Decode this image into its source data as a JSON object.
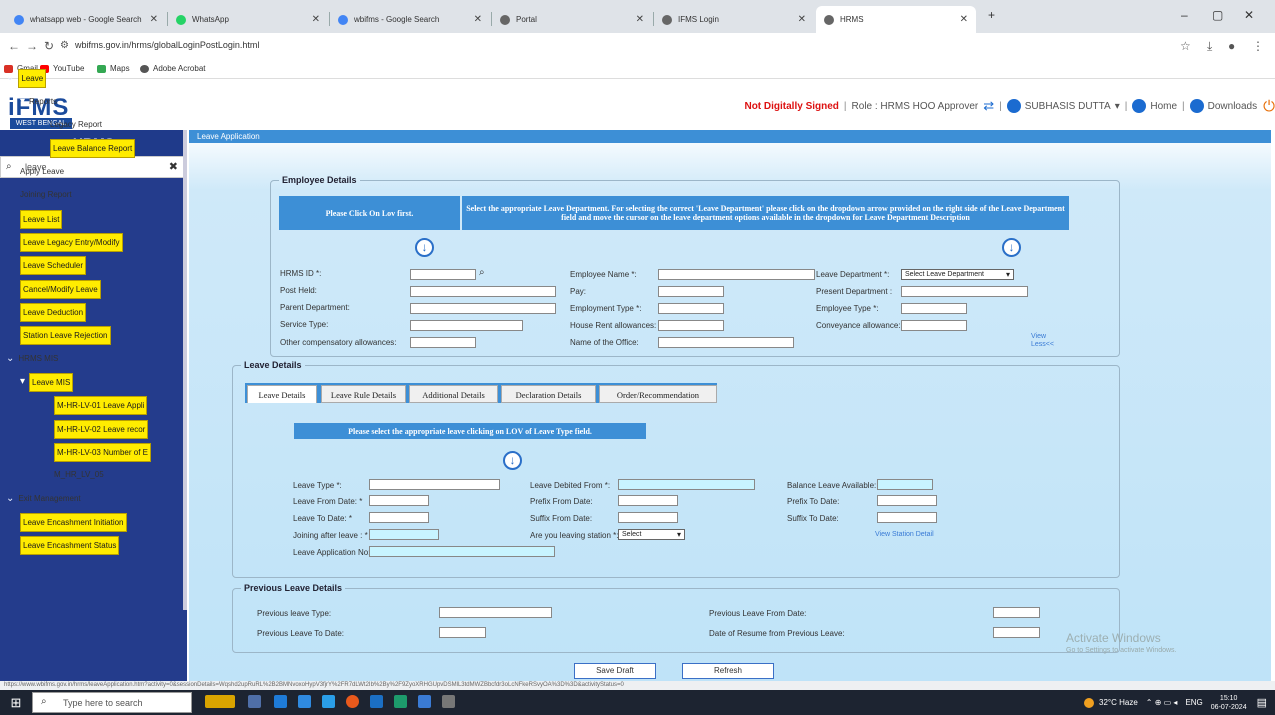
{
  "browser": {
    "tabs": [
      {
        "title": "whatsapp web - Google Search",
        "color": "#4285f4"
      },
      {
        "title": "WhatsApp",
        "color": "#25d366"
      },
      {
        "title": "wbifms - Google Search",
        "color": "#4285f4"
      },
      {
        "title": "Portal",
        "color": "#666666"
      },
      {
        "title": "IFMS Login",
        "color": "#666666"
      },
      {
        "title": "HRMS",
        "color": "#666666"
      }
    ],
    "url": "wbifms.gov.in/hrms/globalLoginPostLogin.html",
    "bookmarks": [
      "Gmail",
      "YouTube",
      "Maps",
      "Adobe Acrobat"
    ]
  },
  "header": {
    "logo": "iFMS",
    "logo_sub": "WEST BENGAL",
    "not_signed": "Not Digitally Signed",
    "role": "Role : HRMS HOO Approver",
    "user": "SUBHASIS DUTTA",
    "home": "Home",
    "downloads": "Downloads"
  },
  "sidebar": {
    "title": "HRMS",
    "search_value": "leave",
    "items": [
      {
        "label": "Leave",
        "hl": true,
        "indent": 0,
        "arrow": "⌄"
      },
      {
        "label": "Reports",
        "hl": false,
        "indent": 1,
        "arrow": "▾"
      },
      {
        "label": "Legacy Report",
        "hl": false,
        "indent": 2,
        "arrow": ""
      },
      {
        "label": "Leave Balance Report",
        "hl": true,
        "indent": 2,
        "arrow": ""
      },
      {
        "label": "Apply Leave",
        "hl": false,
        "indent": 1,
        "arrow": ""
      },
      {
        "label": "Joining Report",
        "hl": false,
        "indent": 1,
        "arrow": ""
      },
      {
        "label": "Leave List",
        "hl": true,
        "indent": 1,
        "arrow": ""
      },
      {
        "label": "Leave Legacy Entry/Modify",
        "hl": true,
        "indent": 1,
        "arrow": ""
      },
      {
        "label": "Leave Scheduler",
        "hl": true,
        "indent": 1,
        "arrow": ""
      },
      {
        "label": "Cancel/Modify Leave",
        "hl": true,
        "indent": 1,
        "arrow": ""
      },
      {
        "label": "Leave Deduction",
        "hl": true,
        "indent": 1,
        "arrow": ""
      },
      {
        "label": "Station Leave Rejection",
        "hl": true,
        "indent": 1,
        "arrow": ""
      },
      {
        "label": "HRMS MIS",
        "hl": false,
        "indent": 0,
        "arrow": "⌄"
      },
      {
        "label": "Leave MIS",
        "hl": true,
        "indent": 1,
        "arrow": "▾"
      },
      {
        "label": "M-HR-LV-01 Leave Appli",
        "hl": true,
        "indent": 3,
        "arrow": ""
      },
      {
        "label": "M-HR-LV-02 Leave recor",
        "hl": true,
        "indent": 3,
        "arrow": ""
      },
      {
        "label": "M-HR-LV-03 Number of E",
        "hl": true,
        "indent": 3,
        "arrow": ""
      },
      {
        "label": "M_HR_LV_05",
        "hl": false,
        "indent": 3,
        "arrow": ""
      },
      {
        "label": "Exit Management",
        "hl": false,
        "indent": 0,
        "arrow": "⌄"
      },
      {
        "label": "Leave Encashment Initiation",
        "hl": true,
        "indent": 1,
        "arrow": ""
      },
      {
        "label": "Leave Encashment Status",
        "hl": true,
        "indent": 1,
        "arrow": ""
      }
    ]
  },
  "main": {
    "bar_title": "Leave Application",
    "employee": {
      "legend": "Employee Details",
      "note_left": "Please Click On Lov first.",
      "note_right": "Select the appropriate Leave Department. For selecting the correct 'Leave Department' please click on the dropdown arrow provided on the right side of the Leave Department field and move the cursor on the leave department options available in the dropdown for Leave Department Description",
      "labels": {
        "hrms_id": "HRMS ID *:",
        "post_held": "Post Held:",
        "parent_dept": "Parent Department:",
        "service_type": "Service Type:",
        "other_comp": "Other compensatory allowances:",
        "emp_name": "Employee Name *:",
        "pay": "Pay:",
        "emp_type": "Employment Type *:",
        "hra": "House Rent allowances:",
        "office": "Name of the Office:",
        "leave_dept": "Leave Department *:",
        "present_dept": "Present Department :",
        "employee_type": "Employee Type *:",
        "conveyance": "Conveyance allowance:"
      },
      "leave_dept_select": "Select Leave Department",
      "view_less": "View Less<<"
    },
    "leave": {
      "legend": "Leave Details",
      "tabs": [
        "Leave Details",
        "Leave Rule Details",
        "Additional Details",
        "Declaration Details",
        "Order/Recommendation"
      ],
      "note": "Please select the appropriate leave clicking on LOV of Leave Type field.",
      "labels": {
        "leave_type": "Leave Type *:",
        "from_date": "Leave From Date: *",
        "to_date": "Leave To Date: *",
        "joining_after": "Joining after leave : *",
        "app_no": "Leave Application No:",
        "debited_from": "Leave Debited From *:",
        "prefix_from": "Prefix From Date:",
        "suffix_from": "Suffix From Date:",
        "leaving_station": "Are you leaving station *:",
        "balance": "Balance Leave Available:",
        "prefix_to": "Prefix To Date:",
        "suffix_to": "Suffix To Date:"
      },
      "station_select": "Select",
      "view_station": "View Station Detail"
    },
    "previous": {
      "legend": "Previous Leave Details",
      "prev_type": "Previous leave Type:",
      "prev_to": "Previous Leave To Date:",
      "prev_from": "Previous Leave From Date:",
      "resume": "Date of Resume from Previous Leave:"
    },
    "buttons": {
      "save_draft": "Save Draft",
      "refresh": "Refresh"
    }
  },
  "watermark": {
    "title": "Activate Windows",
    "sub": "Go to Settings to activate Windows."
  },
  "status_url": "https://www.wbifms.gov.in/hrms/leaveApplication.htm?activity=0&sessionDetails=Wqshd2upRuRL%2B2BMNvoxoHypV3fjrY%2FR7dLWt2Ib%2By%2F9ZyoXRHGUpvDSMlL3tdMWZBbcfdr3oLcNFkeRSvyOA%3D%3D&activityStatus=0",
  "taskbar": {
    "search_placeholder": "Type here to search",
    "weather": "32°C Haze",
    "lang": "ENG",
    "time": "15:10",
    "date": "06-07-2024"
  }
}
